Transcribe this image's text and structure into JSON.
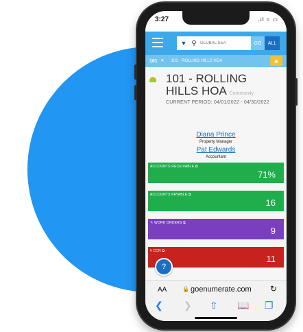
{
  "status": {
    "time": "3:27",
    "signal_icons": ".ıl ≈ ▭"
  },
  "appbar": {
    "search_placeholder": "GLOBAL SEA",
    "go_label": "GO",
    "all_label": "ALL"
  },
  "subbar": {
    "code": "101",
    "name": "101 - ROLLING HILLS HOA"
  },
  "header": {
    "title": "101 - ROLLING HILLS HOA",
    "type": "Community",
    "period": "CURRENT PERIOD: 04/01/2022 - 04/30/2022"
  },
  "contacts": [
    {
      "name": "Diana Prince",
      "role": "Property Manager"
    },
    {
      "name": "Pat Edwards",
      "role": "Accountant"
    }
  ],
  "cards": [
    {
      "label": "ACCOUNTS RECEIVABLE",
      "value": "71%",
      "color": "#1fae4b"
    },
    {
      "label": "ACCOUNTS PAYABLE",
      "value": "16",
      "color": "#1fae4b"
    },
    {
      "label": "WORK ORDERS",
      "value": "9",
      "color": "#7a3fbe"
    },
    {
      "label": "CCR",
      "value": "11",
      "color": "#c8221f"
    }
  ],
  "browser": {
    "text_size_label": "AA",
    "url": "goenumerate.com"
  },
  "icons": {
    "menu": "hamburger-icon",
    "filter": "filter-icon",
    "search": "search-icon",
    "help": "help-icon",
    "lock": "lock-icon",
    "reload": "reload-icon",
    "back": "back-icon",
    "forward": "forward-icon",
    "share": "share-icon",
    "bookmarks": "bookmarks-icon",
    "tabs": "tabs-icon"
  }
}
